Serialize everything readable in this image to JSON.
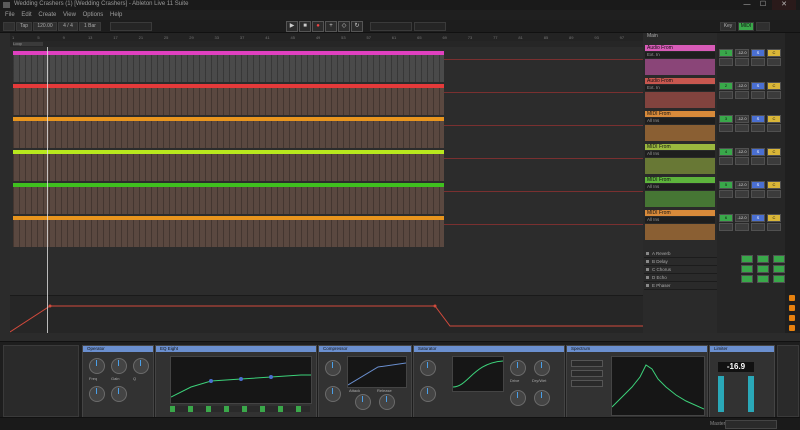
{
  "window": {
    "title": "Wedding Crashers (1) [Wedding Crashers] - Ableton Live 11 Suite",
    "controls": [
      "—",
      "☐",
      "✕"
    ]
  },
  "menu": [
    "File",
    "Edit",
    "Create",
    "View",
    "Options",
    "Help"
  ],
  "control_bar": {
    "tap": "Tap",
    "tempo": "120.00",
    "signature": "4 / 4",
    "quantize": "1 Bar",
    "key": "Key",
    "midi": "MIDI"
  },
  "arrangement": {
    "beats": [
      "1",
      "5",
      "9",
      "13",
      "17",
      "21",
      "25",
      "29",
      "33",
      "37",
      "41",
      "45",
      "49",
      "53",
      "57",
      "61",
      "65",
      "69",
      "73",
      "77",
      "81",
      "85",
      "89",
      "93",
      "97"
    ],
    "loop_label": "Loop",
    "tracks": [
      {
        "name": "1 Vocals",
        "color": "#e040c0"
      },
      {
        "name": "2 Lead",
        "color": "#e63a3a"
      },
      {
        "name": "3 Bass",
        "color": "#e8951e"
      },
      {
        "name": "4 Synth",
        "color": "#b8e81e"
      },
      {
        "name": "5 Pad",
        "color": "#3fc01e"
      },
      {
        "name": "6 Drums",
        "color": "#e8951e"
      }
    ]
  },
  "io": {
    "header": "Main",
    "blocks": [
      {
        "label": "Audio From",
        "value": "Ext. In",
        "color": "#d85bb8"
      },
      {
        "label": "Audio From",
        "value": "Ext. In",
        "color": "#c8574f"
      },
      {
        "label": "MIDI From",
        "value": "All Ins",
        "color": "#d88a3a"
      },
      {
        "label": "MIDI From",
        "value": "All Ins",
        "color": "#9ab83e"
      },
      {
        "label": "MIDI From",
        "value": "All Ins",
        "color": "#5db43c"
      },
      {
        "label": "MIDI From",
        "value": "All Ins",
        "color": "#d88a3a"
      }
    ],
    "returns": [
      "A Reverb",
      "B Delay",
      "C Chorus",
      "D Echo",
      "E Phaser"
    ]
  },
  "mixer": {
    "rows": [
      "1",
      "2",
      "3",
      "4",
      "5",
      "6"
    ],
    "vol": "-12.0",
    "pan": "C",
    "s_label": "S",
    "m_label": "●"
  },
  "device_view": {
    "devices": [
      {
        "name": "Operator",
        "color": "#6a8fcf"
      },
      {
        "name": "EQ Eight",
        "color": "#6a8fcf"
      },
      {
        "name": "Compressor",
        "color": "#6a8fcf"
      },
      {
        "name": "Saturator",
        "color": "#6a8fcf"
      },
      {
        "name": "Spectrum",
        "color": "#6a8fcf"
      },
      {
        "name": "Limiter",
        "color": "#6a8fcf"
      }
    ],
    "level": "-16.9",
    "knob_labels": [
      "Freq",
      "Gain",
      "Q",
      "Attack",
      "Release",
      "Ratio",
      "Drive",
      "Dry/Wet"
    ]
  },
  "status": {
    "label": "Master"
  }
}
